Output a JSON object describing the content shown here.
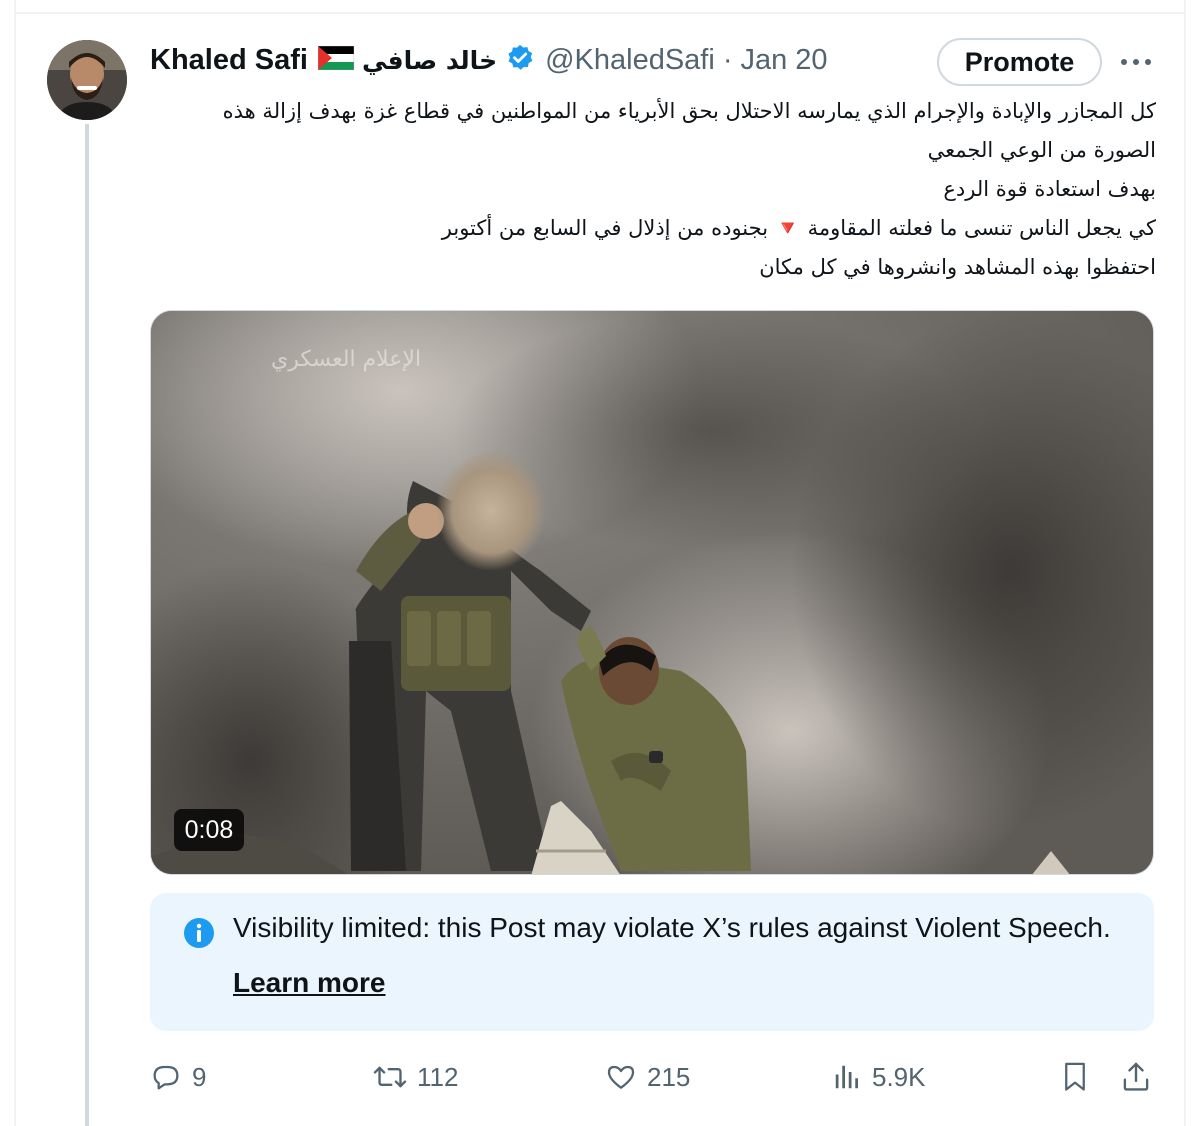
{
  "author": {
    "display_name": "Khaled Safi",
    "arabic_name": "خالد صافي",
    "handle": "@KhaledSafi",
    "separator": "·",
    "date": "Jan 20"
  },
  "buttons": {
    "promote_label": "Promote"
  },
  "tweet": {
    "lines": [
      "كل المجازر والإبادة والإجرام الذي يمارسه الاحتلال بحق الأبرياء من المواطنين في قطاع غزة بهدف إزالة هذه",
      "الصورة من الوعي الجمعي",
      "بهدف استعادة قوة الردع",
      "احتفظوا بهذه المشاهد وانشروها في كل مكان"
    ],
    "line4_part1": "كي يجعل الناس تنسى ما فعلته المقاومة",
    "line4_triangle": "🔻",
    "line4_part2": "بجنوده من إذلال في السابع من أكتوبر"
  },
  "media": {
    "duration": "0:08",
    "watermark": "الإعلام العسكري"
  },
  "notice": {
    "text": "Visibility limited: this Post may violate X’s rules against Violent Speech.",
    "link": "Learn more"
  },
  "actions": {
    "replies": "9",
    "reposts": "112",
    "likes": "215",
    "views": "5.9K"
  },
  "colors": {
    "text_primary": "#0f1419",
    "text_secondary": "#536471",
    "verified_blue": "#1d9bf0",
    "notice_bg": "#eaf5fd",
    "border": "#cfd9de"
  }
}
